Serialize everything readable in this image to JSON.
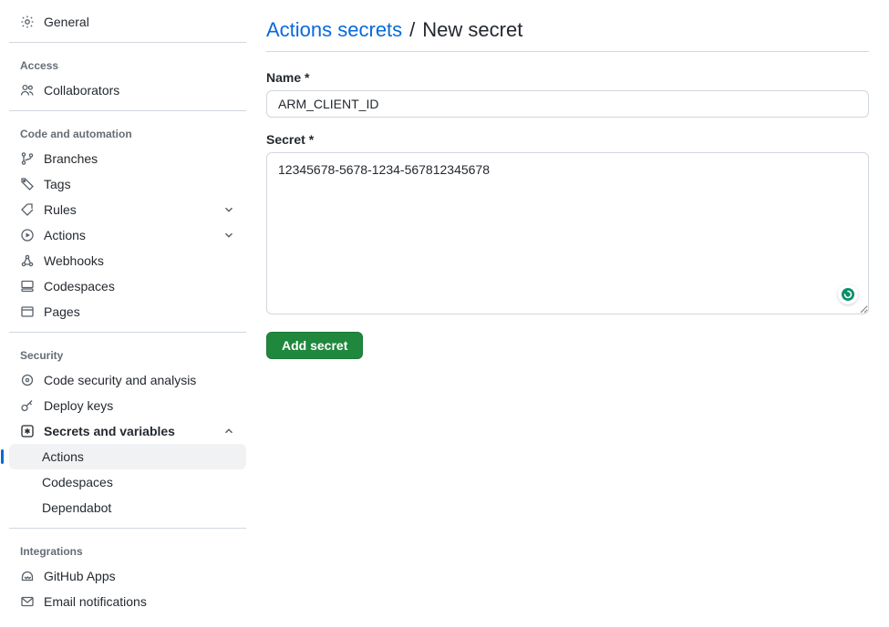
{
  "sidebar": {
    "general": "General",
    "access_hdr": "Access",
    "collaborators": "Collaborators",
    "code_hdr": "Code and automation",
    "branches": "Branches",
    "tags": "Tags",
    "rules": "Rules",
    "actions": "Actions",
    "webhooks": "Webhooks",
    "codespaces": "Codespaces",
    "pages": "Pages",
    "security_hdr": "Security",
    "code_security": "Code security and analysis",
    "deploy_keys": "Deploy keys",
    "secrets_vars": "Secrets and variables",
    "sv_actions": "Actions",
    "sv_codespaces": "Codespaces",
    "sv_dependabot": "Dependabot",
    "integrations_hdr": "Integrations",
    "github_apps": "GitHub Apps",
    "email_notif": "Email notifications"
  },
  "main": {
    "title_link": "Actions secrets",
    "title_sep": "/",
    "title_here": "New secret",
    "name_label": "Name *",
    "name_value": "ARM_CLIENT_ID",
    "secret_label": "Secret *",
    "secret_value": "12345678-5678-1234-567812345678",
    "submit": "Add secret"
  }
}
